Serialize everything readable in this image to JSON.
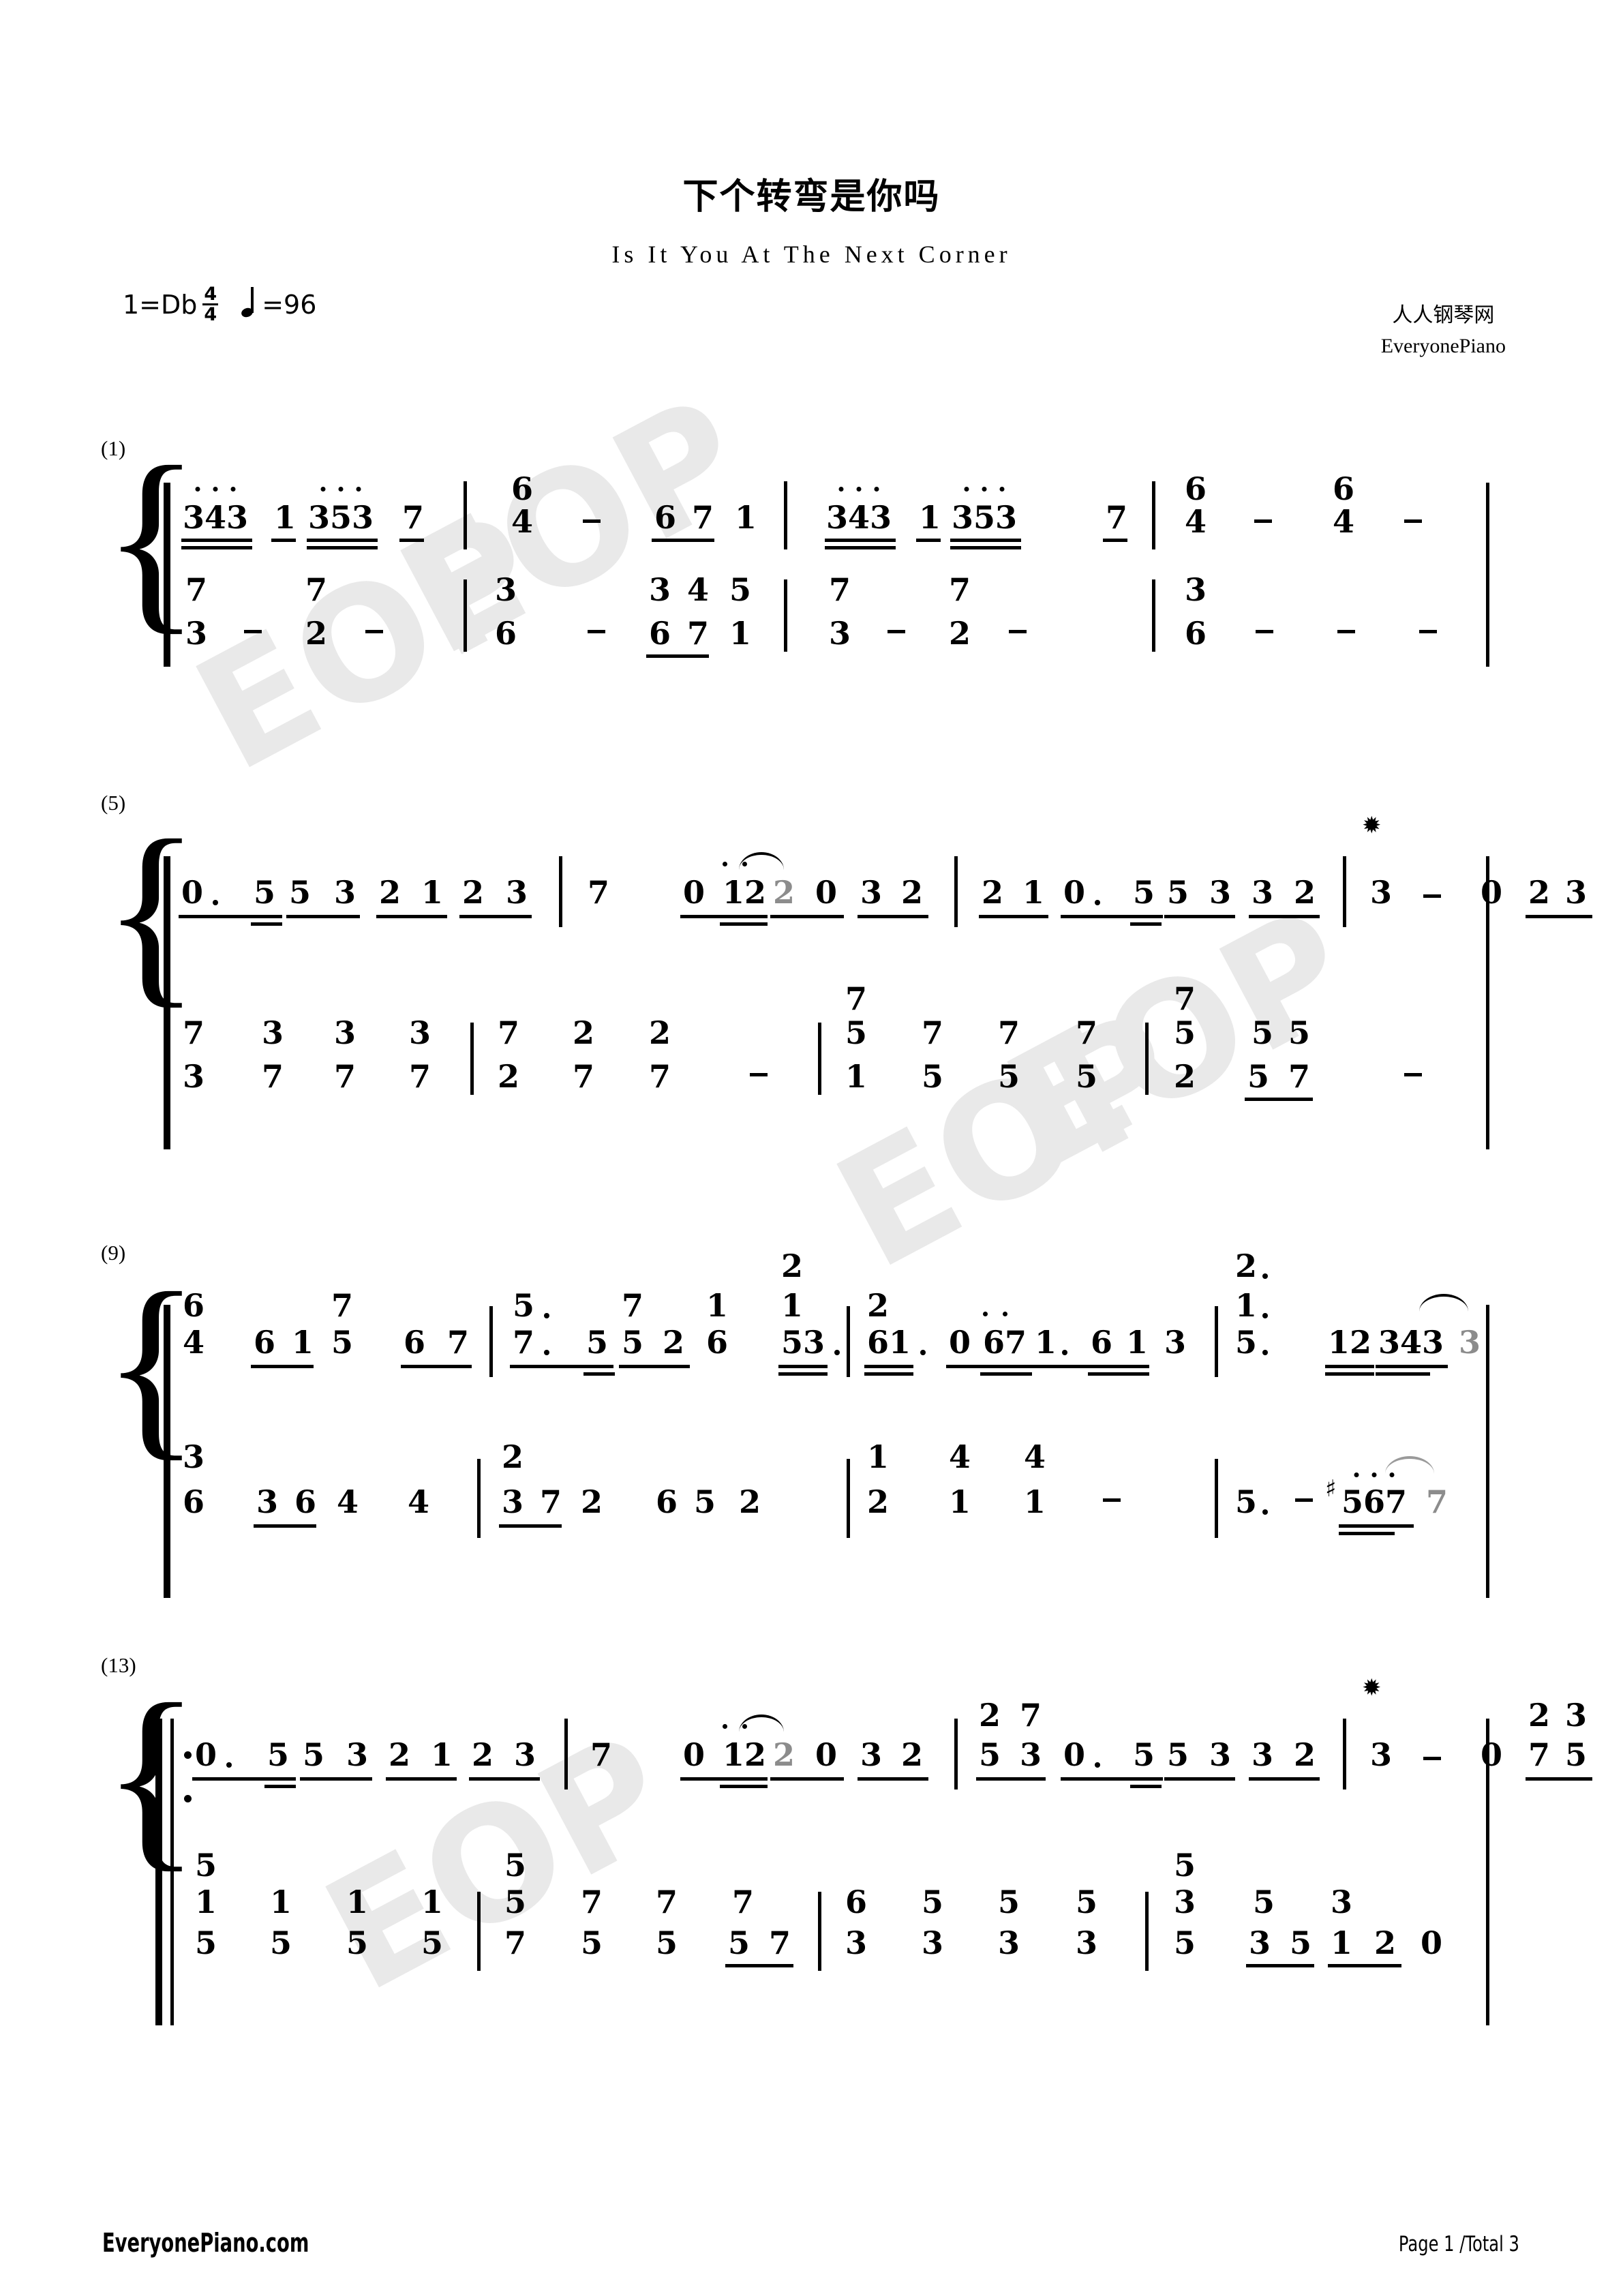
{
  "document": {
    "title": "下个转弯是你吗",
    "subtitle": "Is It You At The Next Corner",
    "key": "1=Db",
    "time_signature_num": "4",
    "time_signature_den": "4",
    "tempo_label": "=96",
    "credit_cn": "人人钢琴网",
    "credit_en": "EveryonePiano",
    "footer_left": "EveryonePiano.com",
    "footer_right": "Page 1 /Total 3",
    "watermark_text": "EOP",
    "notation_type": "jianpu-numbered-musical-notation"
  },
  "score": {
    "systems": [
      {
        "measure_label": "(1)",
        "treble": "343 1 353 7 | 6/4 - 67 1 | 343 1 353 7 | 6/4 - 6/4 -",
        "bass": "7/3 - 7/2 - | 3/6 - 3/6 4/7 5/1 | 7/3 - 7/2 - | 3/6 - - -"
      },
      {
        "measure_label": "(5)",
        "treble": "0. 5 53 21 23 | 7 0 122 0 32 | 21 0. 55 3 32 | 3 - 0 23",
        "bass": "7/3 3/7 3/7 3/7 | 7/2 2/7 2/7 - | 7/5/1 7/5 7/5 7/5 | 7/5/2 5 5/7/5/3 -"
      },
      {
        "measure_label": "(9)",
        "treble": "6/4 61 7/5 67 | 5.7. 5 5 2 1/6 | 2/1/53. 2/61. 0 671. 613 | 2./1./5. 12 343 3",
        "bass": "3/6 36 4 4 | 2/37 2 6/5 2 | 1/2 4/1 4/1 - | 5. - #567 7"
      },
      {
        "measure_label": "(13)",
        "repeat_start": true,
        "treble": "0. 5 53 21 23 | 7 0 122 0 32 | 2/5 7/3 0. 55 3 32 | 3 - 0 2/7 3/5",
        "bass": "5/1/5 1/5 1/5 1/5 | 5/7 5/7 7/5 7/5/7 | 6/3 5/3 5/3 5/3 | 5/3/5 3/5 5/3 1 2 0"
      }
    ]
  }
}
